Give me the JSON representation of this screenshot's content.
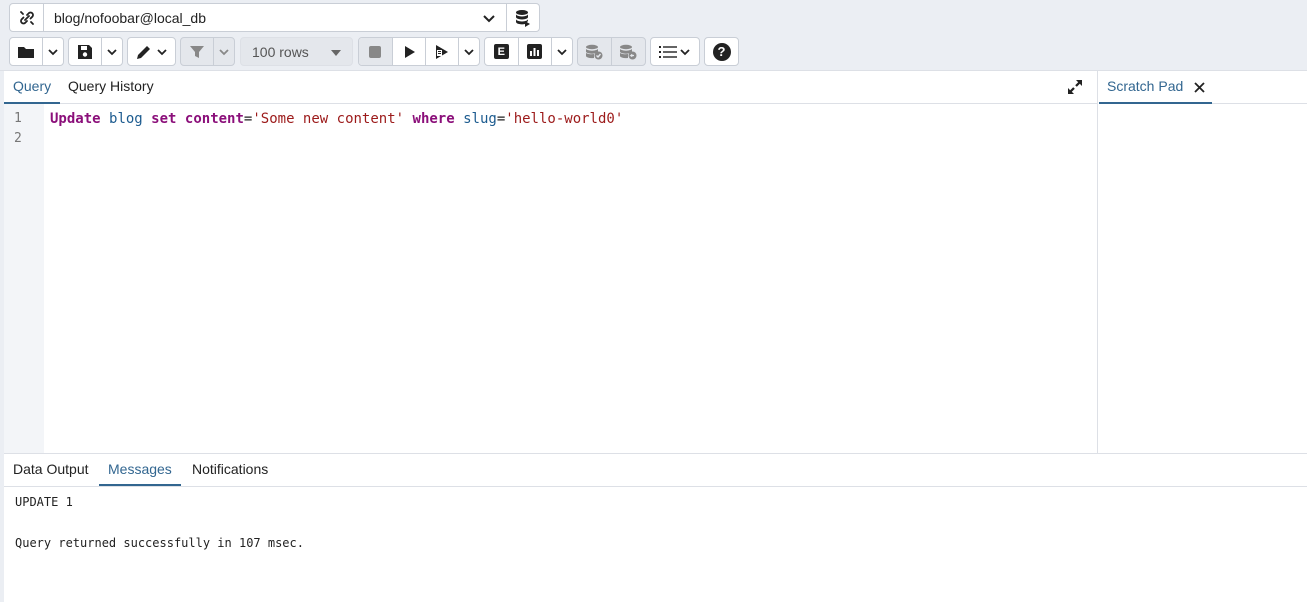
{
  "connection": {
    "label": "blog/nofoobar@local_db",
    "icon": "link-icon",
    "db_icon": "database-icon"
  },
  "toolbar": {
    "open_icon": "folder-icon",
    "save_icon": "save-icon",
    "edit_icon": "pencil-icon",
    "filter_icon": "filter-icon",
    "rows_limit": "100 rows",
    "stop_icon": "stop-icon",
    "execute_icon": "play-icon",
    "execute_script_icon": "play-script-icon",
    "explain_label": "E",
    "explain_analyze_icon": "bar-chart-icon",
    "commit_icon": "database-check-icon",
    "rollback_icon": "database-rollback-icon",
    "macros_icon": "list-icon",
    "help_label": "?"
  },
  "editor": {
    "tabs": [
      "Query",
      "Query History"
    ],
    "active_tab": "Query",
    "line_numbers": [
      "1",
      "2"
    ],
    "code": {
      "kw_update": "Update",
      "table": "blog",
      "kw_set": "set",
      "column": "content",
      "eq1": "=",
      "value": "'Some new content'",
      "kw_where": "where",
      "where_column": "slug",
      "eq2": "=",
      "where_value": "'hello-world0'"
    }
  },
  "scratch_pad": {
    "title": "Scratch Pad"
  },
  "output": {
    "tabs": [
      "Data Output",
      "Messages",
      "Notifications"
    ],
    "active_tab": "Messages",
    "messages": [
      "UPDATE 1",
      "Query returned successfully in 107 msec."
    ]
  },
  "colors": {
    "accent": "#326690",
    "keyword": "#8b0f7a",
    "identifier": "#1c5b8f",
    "string": "#9c1a1a"
  }
}
